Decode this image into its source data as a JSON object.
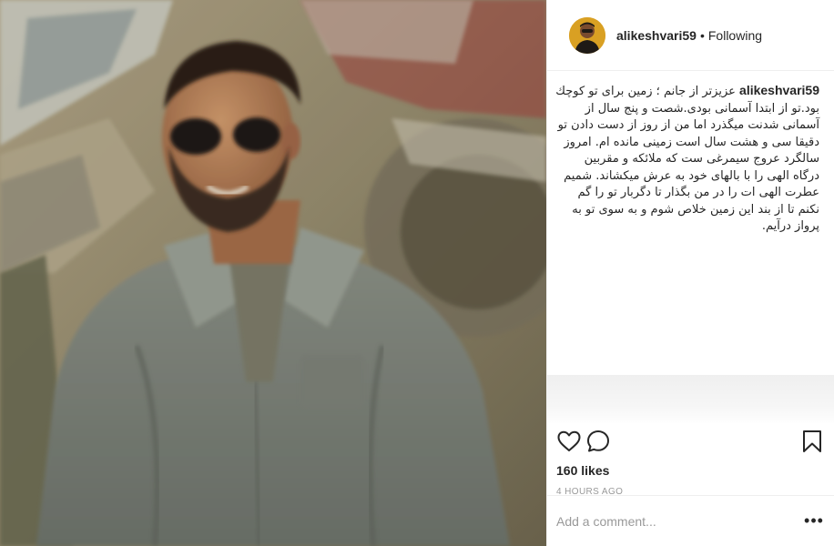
{
  "post": {
    "username": "alikeshvari59",
    "separator": "•",
    "follow_state": "Following",
    "caption": {
      "username": "alikeshvari59",
      "text": "عزیزتر از جانم ؛ زمین برای تو کوچك بود.تو از ابتدا آسمانی بودی.شصت و پنج سال از آسمانی شدنت میگذرد اما من از روز از دست دادن تو دقیقا سی و هشت سال است زمینی مانده ام. امروز سالگرد عروج سیمرغی ست که ملائکه و مقربین درگاه الهی را با بالهای خود به عرش میکشاند. شمیم عطرت الهی ات را در من بگذار تا دگربار تو را گم نکنم تا از بند این زمین خلاص شوم و به سوی تو به پرواز درآیم."
    },
    "likes_text": "160 likes",
    "timestamp": "4 HOURS AGO",
    "comment_placeholder": "Add a comment...",
    "more_label": "•••"
  },
  "icons": {
    "like": "heart-outline-icon",
    "comment": "speech-bubble-icon",
    "save": "bookmark-icon",
    "more": "more-options-icon"
  },
  "colors": {
    "text": "#262626",
    "muted": "#999999",
    "border": "#efefef",
    "avatar_bg": "#d9a023"
  }
}
